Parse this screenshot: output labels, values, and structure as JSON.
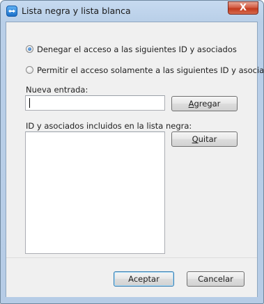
{
  "window": {
    "title": "Lista negra y lista blanca",
    "close_label": "X"
  },
  "options": {
    "deny": "Denegar el acceso a las siguientes ID y asociados",
    "allow": "Permitir el acceso solamente a las siguientes ID y asociados",
    "selected": "deny"
  },
  "new_entry": {
    "label": "Nueva entrada:",
    "value": "",
    "add_label_accel": "A",
    "add_label_rest": "gregar"
  },
  "list": {
    "label": "ID y asociados incluidos en la lista negra:",
    "items": [],
    "remove_label_accel": "Q",
    "remove_label_rest": "uitar"
  },
  "footer": {
    "accept_label": "Aceptar",
    "cancel_label": "Cancelar"
  },
  "colors": {
    "titlebar": "#c6daf0",
    "client_bg": "#f0f0f0",
    "close_button": "#c23a1e",
    "default_button_border": "#3c7fb1"
  },
  "icons": {
    "app": "teamviewer-icon",
    "close": "close-icon"
  }
}
